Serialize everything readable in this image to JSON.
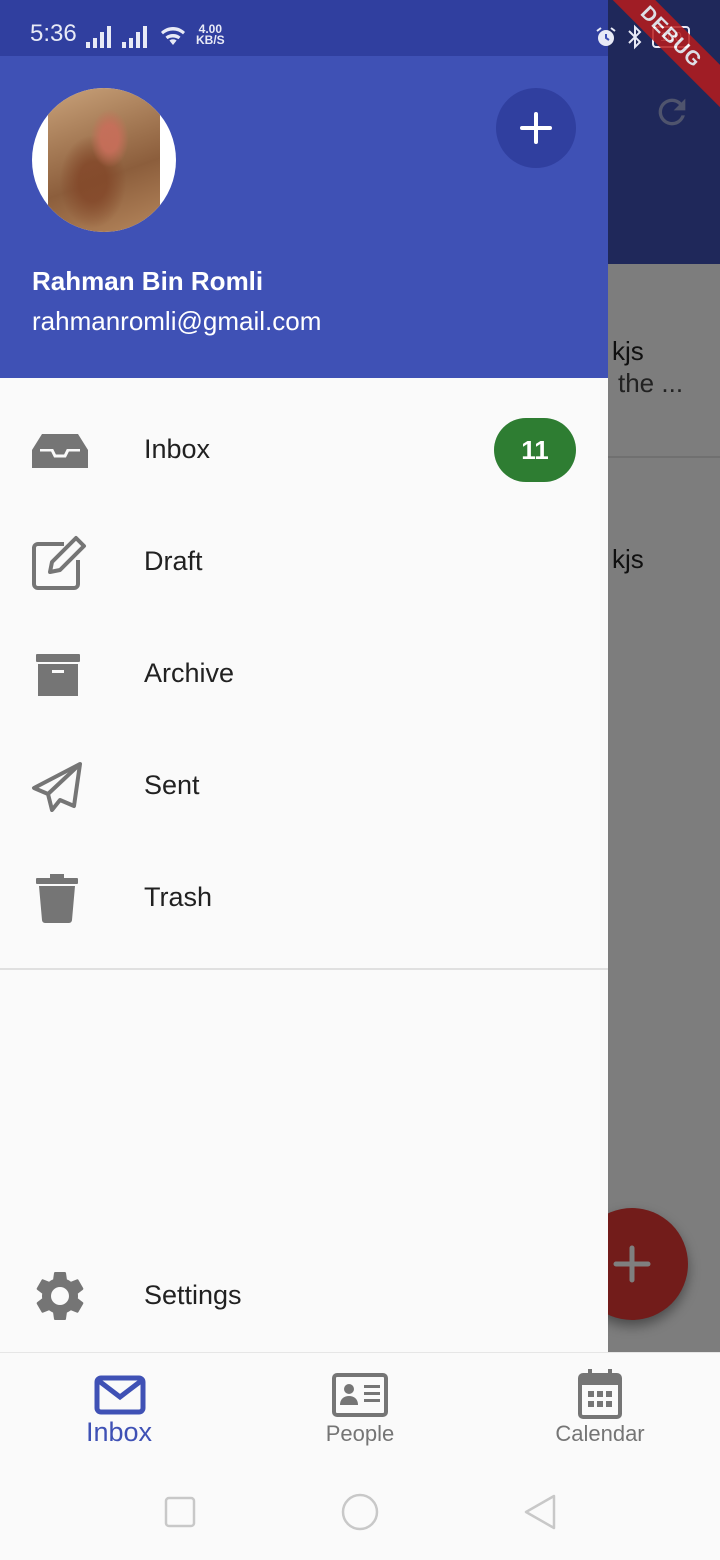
{
  "colors": {
    "primary": "#3f51b5",
    "primary_dark": "#303f9f",
    "badge_green": "#2e7d32",
    "fab_red": "#e53935",
    "icon_grey": "#757575"
  },
  "status_bar": {
    "time": "5:36",
    "net_speed_value": "4.00",
    "net_speed_unit": "KB/S",
    "battery": "100"
  },
  "debug_banner": "DEBUG",
  "background_list": {
    "row1_line1": "kjs",
    "row1_line2": "the ...",
    "row2_line1": "kjs"
  },
  "drawer": {
    "account_name": "Rahman Bin Romli",
    "account_email": "rahmanromli@gmail.com",
    "items": [
      {
        "label": "Inbox",
        "icon": "inbox-icon",
        "badge": "11"
      },
      {
        "label": "Draft",
        "icon": "edit-icon"
      },
      {
        "label": "Archive",
        "icon": "archive-icon"
      },
      {
        "label": "Sent",
        "icon": "paper-plane-icon"
      },
      {
        "label": "Trash",
        "icon": "trash-icon"
      }
    ],
    "settings_label": "Settings"
  },
  "bottom_nav": {
    "items": [
      {
        "label": "Inbox",
        "icon": "envelope-icon",
        "active": true
      },
      {
        "label": "People",
        "icon": "contact-card-icon",
        "active": false
      },
      {
        "label": "Calendar",
        "icon": "calendar-icon",
        "active": false
      }
    ]
  }
}
